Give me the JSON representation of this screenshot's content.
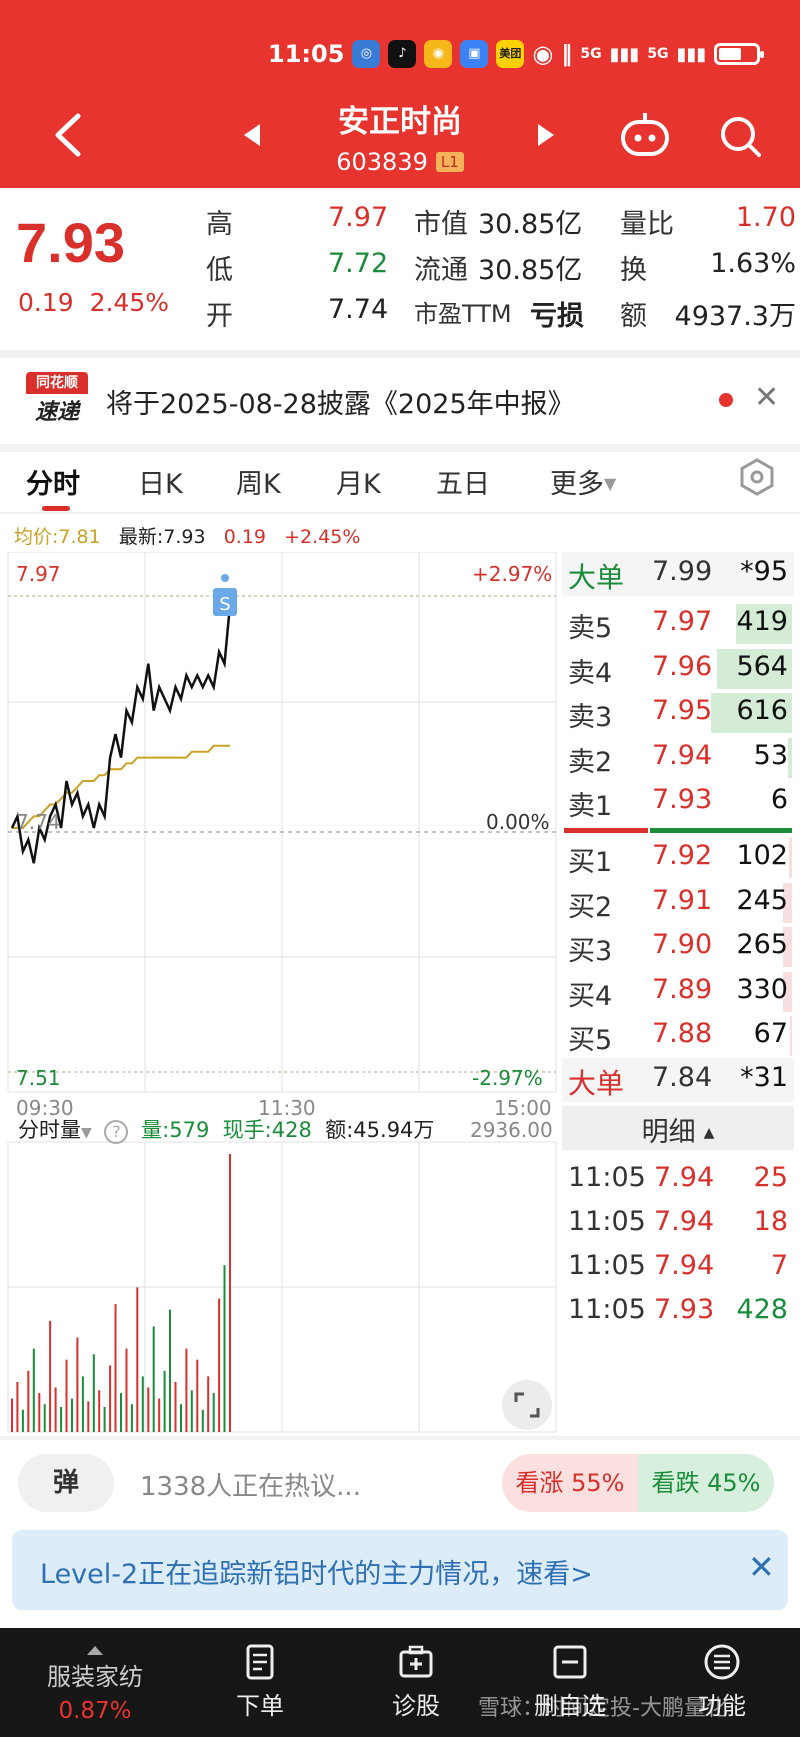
{
  "status_bar": {
    "time": "11:05",
    "signal1": "5G",
    "signal2": "5G",
    "meituan": "美团"
  },
  "header": {
    "title": "安正时尚",
    "code": "603839",
    "level_badge": "L1"
  },
  "quote": {
    "price": "7.93",
    "change": "0.19",
    "change_pct": "2.45%",
    "high_label": "高",
    "high": "7.97",
    "low_label": "低",
    "low": "7.72",
    "open_label": "开",
    "open": "7.74",
    "mktcap_label": "市值",
    "mktcap": "30.85亿",
    "float_label": "流通",
    "float": "30.85亿",
    "pe_label": "市盈TTM",
    "pe": "亏损",
    "vol_ratio_label": "量比",
    "vol_ratio": "1.70",
    "turnover_label": "换",
    "turnover": "1.63%",
    "amount_label": "额",
    "amount": "4937.3万"
  },
  "notice": {
    "logo_top": "同花顺",
    "logo_bottom": "速递",
    "text": "将于2025-08-28披露《2025年中报》"
  },
  "tabs": [
    "分时",
    "日K",
    "周K",
    "月K",
    "五日",
    "更多"
  ],
  "chart_info": {
    "avg_label": "均价:7.81",
    "latest_label": "最新:7.93",
    "change": "0.19",
    "change_pct": "+2.45%"
  },
  "axis": {
    "top_price": "7.97",
    "bottom_price": "7.51",
    "mid_price": "7.74",
    "top_pct": "+2.97%",
    "mid_pct": "0.00%",
    "bottom_pct": "-2.97%",
    "t_start": "09:30",
    "t_mid": "11:30",
    "t_end": "15:00",
    "vol_max": "2936.00",
    "marker": "S"
  },
  "chart_data": {
    "type": "line",
    "ylim": [
      7.51,
      7.97
    ],
    "series": [
      {
        "values": [
          7.74,
          7.75,
          7.72,
          7.73,
          7.71,
          7.74,
          7.73,
          7.75,
          7.76,
          7.74,
          7.78,
          7.76,
          7.77,
          7.75,
          7.76,
          7.74,
          7.76,
          7.75,
          7.8,
          7.82,
          7.8,
          7.84,
          7.83,
          7.86,
          7.85,
          7.88,
          7.84,
          7.86,
          7.85,
          7.84,
          7.86,
          7.85,
          7.87,
          7.86,
          7.87,
          7.86,
          7.87,
          7.86,
          7.89,
          7.88,
          7.93
        ]
      },
      {
        "values": [
          7.74,
          7.74,
          7.74,
          7.745,
          7.75,
          7.75,
          7.755,
          7.76,
          7.76,
          7.765,
          7.77,
          7.77,
          7.775,
          7.78,
          7.78,
          7.78,
          7.785,
          7.785,
          7.79,
          7.79,
          7.79,
          7.795,
          7.795,
          7.8,
          7.8,
          7.8,
          7.8,
          7.8,
          7.8,
          7.8,
          7.8,
          7.8,
          7.8,
          7.805,
          7.805,
          7.805,
          7.805,
          7.81,
          7.81,
          7.81,
          7.81
        ]
      }
    ],
    "volumes": [
      12,
      18,
      8,
      22,
      30,
      14,
      10,
      40,
      16,
      9,
      26,
      12,
      34,
      20,
      11,
      28,
      15,
      9,
      24,
      46,
      14,
      30,
      10,
      52,
      20,
      16,
      38,
      12,
      22,
      44,
      18,
      10,
      30,
      15,
      26,
      8,
      20,
      14,
      48,
      60,
      100
    ]
  },
  "order_book": {
    "big_sell": {
      "label": "大单",
      "price": "7.99",
      "vol": "*95"
    },
    "asks": [
      {
        "label": "卖5",
        "price": "7.97",
        "vol": "419",
        "bar": 0.62
      },
      {
        "label": "卖4",
        "price": "7.96",
        "vol": "564",
        "bar": 0.83
      },
      {
        "label": "卖3",
        "price": "7.95",
        "vol": "616",
        "bar": 0.9
      },
      {
        "label": "卖2",
        "price": "7.94",
        "vol": "53",
        "bar": 0.04
      },
      {
        "label": "卖1",
        "price": "7.93",
        "vol": "6",
        "bar": 0.0
      }
    ],
    "bids": [
      {
        "label": "买1",
        "price": "7.92",
        "vol": "102",
        "bar": 0.03
      },
      {
        "label": "买2",
        "price": "7.91",
        "vol": "245",
        "bar": 0.1
      },
      {
        "label": "买3",
        "price": "7.90",
        "vol": "265",
        "bar": 0.1
      },
      {
        "label": "买4",
        "price": "7.89",
        "vol": "330",
        "bar": 0.1
      },
      {
        "label": "买5",
        "price": "7.88",
        "vol": "67",
        "bar": 0.02
      }
    ],
    "big_buy": {
      "label": "大单",
      "price": "7.84",
      "vol": "*31"
    },
    "detail_label": "明细",
    "ticks": [
      {
        "time": "11:05",
        "price": "7.94",
        "vol": "25"
      },
      {
        "time": "11:05",
        "price": "7.94",
        "vol": "18"
      },
      {
        "time": "11:05",
        "price": "7.94",
        "vol": "7"
      },
      {
        "time": "11:05",
        "price": "7.93",
        "vol": "428"
      }
    ]
  },
  "volume_info": {
    "label": "分时量",
    "vol": "量:579",
    "cur": "现手:428",
    "amount": "额:45.94万"
  },
  "discussion": {
    "danmu": "弹",
    "text": "1338人正在热议...",
    "bull": "看涨 55%",
    "bear": "看跌 45%"
  },
  "promo": {
    "text": "Level-2正在追踪新铝时代的主力情况，速看>"
  },
  "bottom_nav": {
    "industry_name": "服装家纺",
    "industry_change": "0.87%",
    "items": [
      "下单",
      "诊股",
      "删自选",
      "功能"
    ],
    "watermark": "雪球：时间定投-大鹏量化"
  }
}
